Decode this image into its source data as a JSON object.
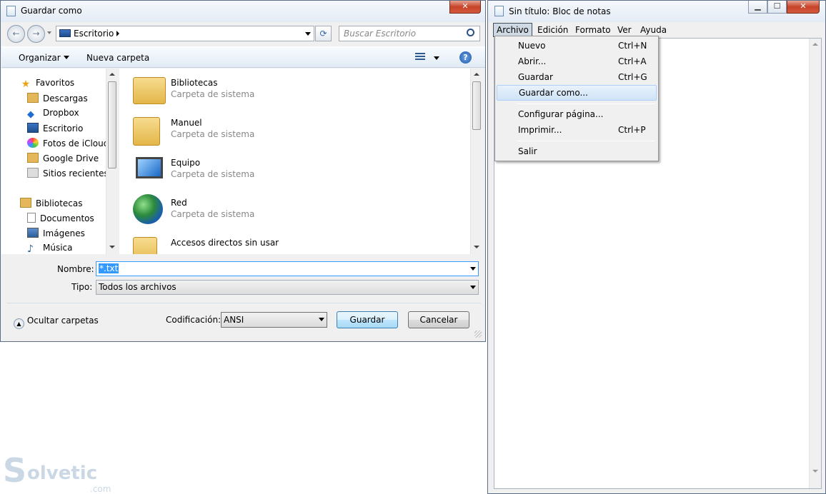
{
  "save_dialog": {
    "title": "Guardar como",
    "address": {
      "location": "Escritorio"
    },
    "search": {
      "placeholder": "Buscar Escritorio"
    },
    "toolbar": {
      "organize": "Organizar",
      "new_folder": "Nueva carpeta"
    },
    "favorites_header": "Favoritos",
    "favorites": [
      "Descargas",
      "Dropbox",
      "Escritorio",
      "Fotos de iCloud",
      "Google Drive",
      "Sitios recientes"
    ],
    "libraries_header": "Bibliotecas",
    "libraries": [
      "Documentos",
      "Imágenes",
      "Música"
    ],
    "files": [
      {
        "name": "Bibliotecas",
        "type": "Carpeta de sistema",
        "icon": "libraries-folder-icon"
      },
      {
        "name": "Manuel",
        "type": "Carpeta de sistema",
        "icon": "user-folder-icon"
      },
      {
        "name": "Equipo",
        "type": "Carpeta de sistema",
        "icon": "computer-icon"
      },
      {
        "name": "Red",
        "type": "Carpeta de sistema",
        "icon": "network-icon"
      },
      {
        "name": "Accesos directos sin usar",
        "type": "",
        "icon": "shortcut-folder-icon"
      }
    ],
    "filename_label": "Nombre:",
    "filename_value": "*.txt",
    "type_label": "Tipo:",
    "type_value": "Todos los archivos",
    "hide_folders": "Ocultar carpetas",
    "encoding_label": "Codificación:",
    "encoding_value": "ANSI",
    "save_button": "Guardar",
    "cancel_button": "Cancelar"
  },
  "notepad": {
    "title": "Sin título: Bloc de notas",
    "menubar": [
      "Archivo",
      "Edición",
      "Formato",
      "Ver",
      "Ayuda"
    ],
    "file_menu": [
      {
        "label": "Nuevo",
        "shortcut": "Ctrl+N"
      },
      {
        "label": "Abrir...",
        "shortcut": "Ctrl+A"
      },
      {
        "label": "Guardar",
        "shortcut": "Ctrl+G"
      },
      {
        "label": "Guardar como...",
        "shortcut": ""
      },
      {
        "label": "Configurar página...",
        "shortcut": ""
      },
      {
        "label": "Imprimir...",
        "shortcut": "Ctrl+P"
      },
      {
        "label": "Salir",
        "shortcut": ""
      }
    ]
  },
  "watermark": {
    "brand": "olvetic",
    "suffix": ".com"
  },
  "colors": {
    "accent": "#3399ff",
    "selection_highlight": "#cfe3f7"
  }
}
